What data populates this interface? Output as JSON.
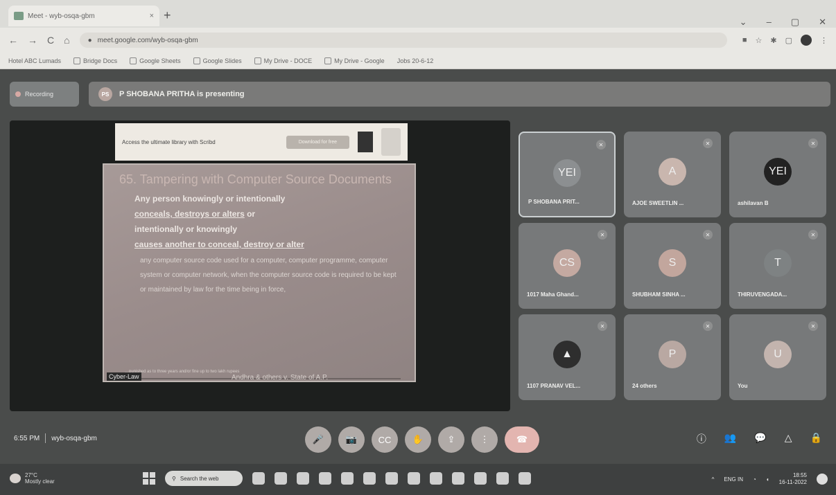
{
  "browser": {
    "tab_title": "Meet - wyb-osqa-gbm",
    "tab_close": "×",
    "new_tab": "+",
    "window_controls": [
      "⌄",
      "–",
      "▢",
      "✕"
    ],
    "nav": {
      "back": "←",
      "forward": "→",
      "reload": "C",
      "home": "⌂"
    },
    "url": "meet.google.com/wyb-osqa-gbm",
    "bookmarks": [
      "Hotel ABC Lumads",
      "Bridge Docs",
      "Google Sheets",
      "Google Slides",
      "My Drive - DOCE",
      "My Drive - Google",
      "Jobs 20-6-12"
    ]
  },
  "meet": {
    "recording_label": "Recording",
    "presenter_avatar": "PS",
    "presenting_text": "P SHOBANA PRITHA is presenting",
    "ad": {
      "text": "Access the ultimate library with Scribd",
      "button": "Download for free"
    },
    "slide": {
      "title": "65. Tampering with Computer Source Documents",
      "lead_1": "Any person knowingly or intentionally",
      "lead_2": "conceals, destroys or alters",
      "lead_3": "or",
      "lead_4": "intentionally or knowingly",
      "lead_5": "causes another to conceal, destroy or alter",
      "body": "any computer source code used for a computer, computer programme, computer system or computer network, when the computer source code is required to be kept or maintained by law for the time being in force,",
      "footer": "…punished as to three years and/or fine up to two lakh rupees"
    },
    "caption_left": "Cyber-Law",
    "caption_right": "Andhra & others v. State of A.P.",
    "participants": [
      {
        "name": "P SHOBANA PRIT...",
        "avatar": "YEI",
        "color": "#8c8f91",
        "active": true
      },
      {
        "name": "AJOE SWEETLIN ...",
        "avatar": "A",
        "color": "#c9b6ae",
        "active": false
      },
      {
        "name": "ashilavan B",
        "avatar": "YEI",
        "color": "#222222",
        "active": false
      },
      {
        "name": "1017 Maha Ghand...",
        "avatar": "CS",
        "color": "#c4a9a1",
        "active": false
      },
      {
        "name": "SHUBHAM SINHA ...",
        "avatar": "S",
        "color": "#c2a69d",
        "active": false
      },
      {
        "name": "THIRUVENGADA...",
        "avatar": "T",
        "color": "#7e8283",
        "active": false
      },
      {
        "name": "1107 PRANAV VEL...",
        "avatar": "▲",
        "color": "#2e2e2e",
        "active": false
      },
      {
        "name": "24 others",
        "avatar": "P",
        "color": "#b9a8a2",
        "active": false
      },
      {
        "name": "You",
        "avatar": "U",
        "color": "#c3b4ae",
        "active": false
      }
    ],
    "time": "6:55 PM",
    "meeting_code": "wyb-osqa-gbm",
    "controls": [
      "🎤",
      "📷",
      "CC",
      "✋",
      "⇪",
      "⋮",
      "☎"
    ],
    "right_controls": [
      "ⓘ",
      "👥",
      "💬",
      "△",
      "🔒"
    ]
  },
  "taskbar": {
    "weather_temp": "27°C",
    "weather_desc": "Mostly clear",
    "search_placeholder": "Search the web",
    "lang": "ENG IN",
    "time": "18:55",
    "date": "16-11-2022"
  }
}
